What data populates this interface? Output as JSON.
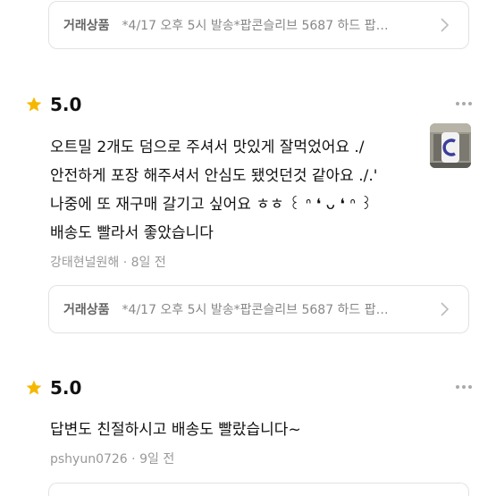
{
  "trade_items": [
    {
      "label": "거래상품",
      "text": "*4/17 오후 5시 발송*팝콘슬리브 5687 하드 팝…"
    },
    {
      "label": "거래상품",
      "text": "*4/17 오후 5시 발송*팝콘슬리브 5687 하드 팝…"
    }
  ],
  "reviews": [
    {
      "score": "5.0",
      "lines": [
        "오트밀 2개도 덤으로 주셔서 맛있게 잘먹었어요 ./",
        "안전하게 포장 해주셔서 안심도 됐엇던것 같아요 ./.'",
        "나중에 또 재구매 갈기고 싶어요 ㅎㅎ ꒰ ᐢ ❛ ᴗ ❛ ᐢ ꒱",
        "배송도 빨라서 좋았습니다"
      ],
      "author": "강태현널원해",
      "time": "8일 전"
    },
    {
      "score": "5.0",
      "lines": [
        "답변도 친절하시고 배송도 빨랐습니다~"
      ],
      "author": "pshyun0726",
      "time": "9일 전"
    }
  ],
  "colors": {
    "star": "#f5b800",
    "border": "#e2e2e2",
    "meta": "#999999"
  }
}
